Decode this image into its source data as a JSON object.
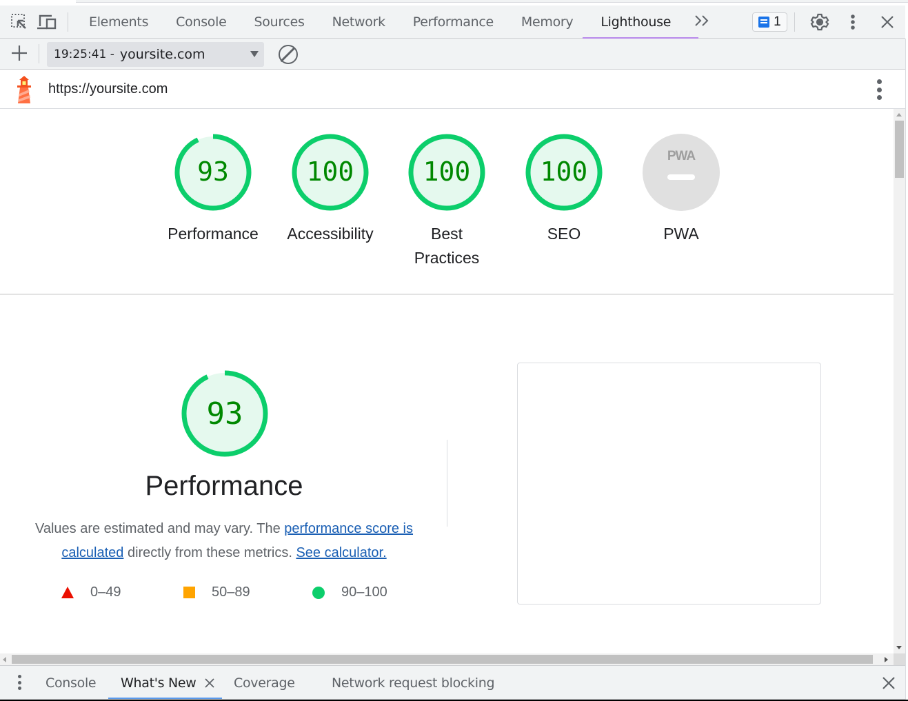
{
  "devtools": {
    "tabs": [
      {
        "label": "Elements",
        "active": false
      },
      {
        "label": "Console",
        "active": false
      },
      {
        "label": "Sources",
        "active": false
      },
      {
        "label": "Network",
        "active": false
      },
      {
        "label": "Performance",
        "active": false
      },
      {
        "label": "Memory",
        "active": false
      },
      {
        "label": "Lighthouse",
        "active": true
      }
    ],
    "more_tabs_label": "»",
    "issues_count": "1",
    "accent_color": "#b788ea"
  },
  "toolbar": {
    "report_time": "19:25:41 -",
    "report_site": "yoursite.com"
  },
  "report": {
    "url": "https://yoursite.com",
    "categories": [
      {
        "label": "Performance",
        "score": 93,
        "display": "93"
      },
      {
        "label": "Accessibility",
        "score": 100,
        "display": "100"
      },
      {
        "label": "Best Practices",
        "score": 100,
        "display": "100"
      },
      {
        "label": "SEO",
        "score": 100,
        "display": "100"
      },
      {
        "label": "PWA",
        "score": null,
        "display": "PWA"
      }
    ],
    "performance": {
      "score": 93,
      "display": "93",
      "title": "Performance",
      "desc_prefix": "Values are estimated and may vary. The ",
      "desc_link1": "performance score is calculated",
      "desc_middle": " directly from these metrics. ",
      "desc_link2": "See calculator."
    },
    "legend": [
      {
        "range": "0–49",
        "shape": "triangle",
        "color": "#eb0f00"
      },
      {
        "range": "50–89",
        "shape": "square",
        "color": "#ffa400"
      },
      {
        "range": "90–100",
        "shape": "circle",
        "color": "#0cce6b"
      }
    ],
    "colors": {
      "pass_stroke": "#0cce6b",
      "pass_fill": "#e5f9ee",
      "pass_text": "#008800",
      "na_fill": "#e0e0e0"
    }
  },
  "drawer": {
    "tabs": [
      {
        "label": "Console",
        "active": false
      },
      {
        "label": "What's New",
        "active": true
      },
      {
        "label": "Coverage",
        "active": false
      },
      {
        "label": "Network request blocking",
        "active": false
      }
    ]
  }
}
